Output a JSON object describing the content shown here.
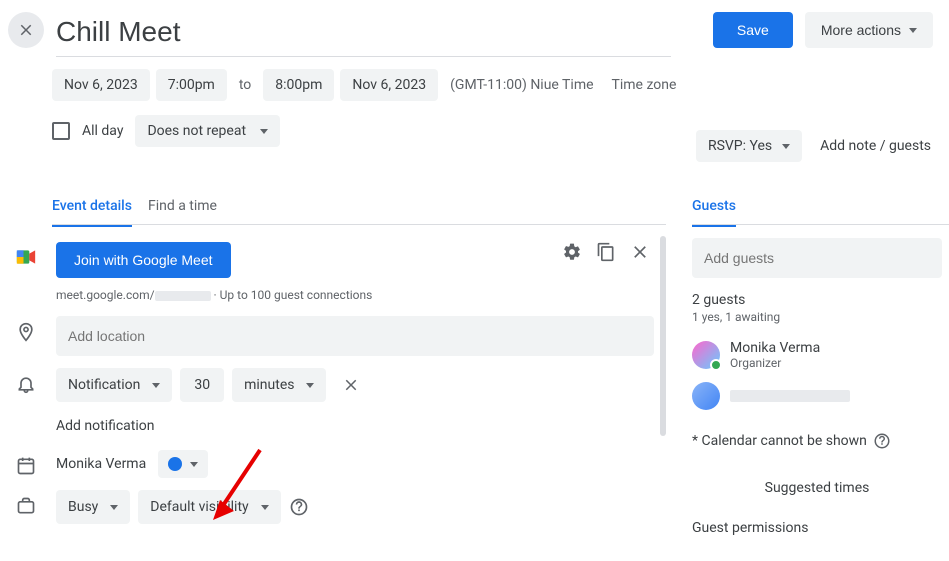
{
  "header": {
    "title": "Chill Meet",
    "save_label": "Save",
    "more_actions_label": "More actions"
  },
  "datetime": {
    "start_date": "Nov 6, 2023",
    "start_time": "7:00pm",
    "to_label": "to",
    "end_time": "8:00pm",
    "end_date": "Nov 6, 2023",
    "tz_text": "(GMT-11:00) Niue Time",
    "tz_link": "Time zone"
  },
  "allday": {
    "label": "All day",
    "repeat": "Does not repeat"
  },
  "rsvp": {
    "label": "RSVP: Yes",
    "add_note": "Add note / guests"
  },
  "tabs": {
    "event_details": "Event details",
    "find_time": "Find a time",
    "guests": "Guests"
  },
  "meet": {
    "join_label": "Join with Google Meet",
    "link_prefix": "meet.google.com/",
    "link_suffix": " · Up to 100 guest connections"
  },
  "location": {
    "placeholder": "Add location"
  },
  "notification": {
    "type": "Notification",
    "value": "30",
    "unit": "minutes",
    "add_label": "Add notification"
  },
  "calendar": {
    "owner": "Monika Verma"
  },
  "availability": {
    "busy": "Busy",
    "visibility": "Default visibility"
  },
  "guests_panel": {
    "add_placeholder": "Add guests",
    "count": "2 guests",
    "status": "1 yes, 1 awaiting",
    "organizer_name": "Monika Verma",
    "organizer_role": "Organizer",
    "warning": "* Calendar cannot be shown",
    "suggested": "Suggested times",
    "permissions": "Guest permissions"
  }
}
